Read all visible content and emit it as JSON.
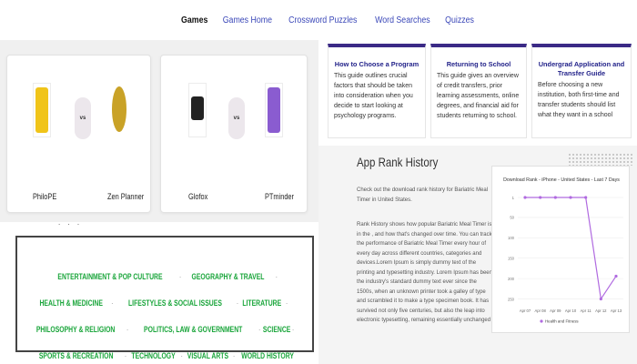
{
  "nav": {
    "items": [
      {
        "label": "Games",
        "active": true
      },
      {
        "label": "Games Home",
        "active": false
      },
      {
        "label": "Crossword Puzzles",
        "active": false
      },
      {
        "label": "Word Searches",
        "active": false
      },
      {
        "label": "Quizzes",
        "active": false
      }
    ]
  },
  "compare": {
    "vs_label": "vs",
    "cards": [
      {
        "left": {
          "name": "PhiloPE",
          "color": "#f0c419"
        },
        "right": {
          "name": "Zen Planner",
          "color": "#c9a227"
        }
      },
      {
        "left": {
          "name": "Glofox",
          "color": "#222222"
        },
        "right": {
          "name": "PTminder",
          "color": "#8a5cd0"
        }
      }
    ]
  },
  "categories": {
    "dots": ". . .",
    "items": [
      "ENTERTAINMENT & POP CULTURE",
      "GEOGRAPHY & TRAVEL",
      "HEALTH & MEDICINE",
      "LIFESTYLES & SOCIAL ISSUES",
      "LITERATURE",
      "PHILOSOPHY & RELIGION",
      "POLITICS, LAW & GOVERNMENT",
      "SCIENCE",
      "SPORTS & RECREATION",
      "TECHNOLOGY",
      "VISUAL ARTS",
      "WORLD HISTORY"
    ],
    "color": "#19a53a"
  },
  "guides": [
    {
      "title": "How to Choose a Program",
      "text": "This guide outlines crucial factors that should be taken into consideration when you decide to start looking at psychology programs."
    },
    {
      "title": "Returning to School",
      "text": "This guide gives an overview of credit transfers, prior learning assessments, online degrees, and financial aid for students returning to school."
    },
    {
      "title": "Undergrad Application and Transfer Guide",
      "text": "Before choosing a new institution, both first-time and transfer students should list what they want in a school"
    }
  ],
  "rank": {
    "title": "App Rank History",
    "p1": "Check out the download rank history for Bariatric Meal Timer in United States.",
    "p2": "Rank History shows how popular Bariatric Meal Timer is in the , and how that's changed over time. You can track the performance of Bariatric Meal Timer every hour of every day across different countries, categories and devices.Lorem Ipsum is simply dummy text of the printing and typesetting industry. Lorem Ipsum has been the industry's standard dummy text ever since the 1500s, when an unknown printer took a galley of type and scrambled it to make a type specimen book. It has survived not only five centuries, but also the leap into electronic typesetting, remaining essentially unchanged"
  },
  "chart_data": {
    "type": "line",
    "title": "Download Rank - iPhone - United States - Last 7 Days",
    "categories": [
      "Apr 07",
      "Apr 08",
      "Apr 09",
      "Apr 10",
      "Apr 11",
      "Apr 12",
      "Apr 13"
    ],
    "series": [
      {
        "name": "Health and Fitness",
        "values": [
          1,
          1,
          1,
          1,
          1,
          250,
          194
        ],
        "color": "#b06ae0"
      }
    ],
    "yticks": [
      1,
      50,
      100,
      150,
      200,
      250
    ],
    "ylim": [
      1,
      260
    ],
    "inverted": true,
    "legend": "bottom",
    "grid": true
  }
}
